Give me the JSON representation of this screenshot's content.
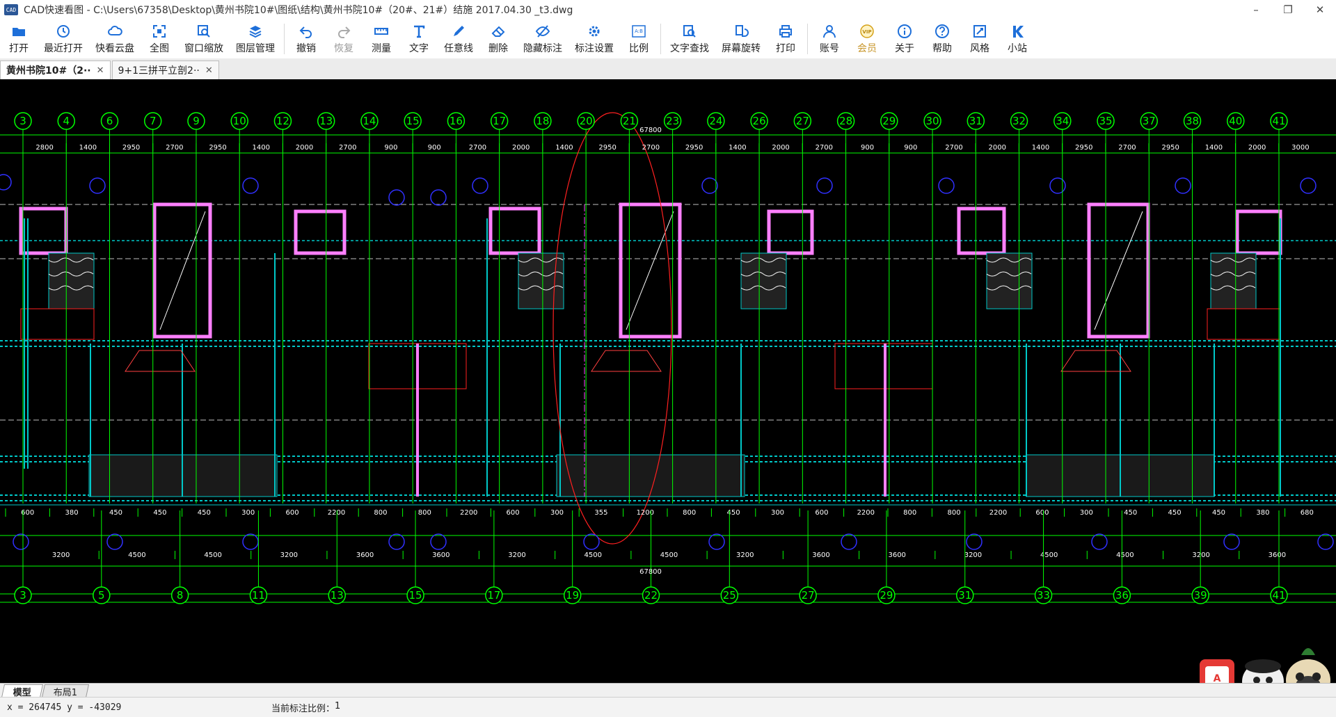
{
  "window": {
    "app_icon_text": "CAD",
    "title": "CAD快速看图 - C:\\Users\\67358\\Desktop\\黄州书院10#\\图纸\\结构\\黄州书院10#（20#、21#）结施 2017.04.30 _t3.dwg",
    "controls": {
      "minimize": "–",
      "restore": "❐",
      "close": "✕"
    }
  },
  "toolbar": {
    "items": [
      {
        "label": "打开",
        "icon": "folder-icon"
      },
      {
        "label": "最近打开",
        "icon": "clock-icon"
      },
      {
        "label": "快看云盘",
        "icon": "cloud-icon"
      },
      {
        "label": "全图",
        "icon": "fullview-icon"
      },
      {
        "label": "窗口缩放",
        "icon": "zoom-window-icon"
      },
      {
        "label": "图层管理",
        "icon": "layers-icon"
      },
      {
        "label": "撤销",
        "icon": "undo-icon"
      },
      {
        "label": "恢复",
        "icon": "redo-icon"
      },
      {
        "label": "测量",
        "icon": "ruler-icon"
      },
      {
        "label": "文字",
        "icon": "text-icon"
      },
      {
        "label": "任意线",
        "icon": "pencil-icon"
      },
      {
        "label": "删除",
        "icon": "eraser-icon"
      },
      {
        "label": "隐藏标注",
        "icon": "eye-hide-icon"
      },
      {
        "label": "标注设置",
        "icon": "gear-icon"
      },
      {
        "label": "比例",
        "icon": "scale-icon"
      },
      {
        "label": "文字查找",
        "icon": "text-search-icon"
      },
      {
        "label": "屏幕旋转",
        "icon": "rotate-icon"
      },
      {
        "label": "打印",
        "icon": "printer-icon"
      },
      {
        "label": "账号",
        "icon": "user-icon"
      },
      {
        "label": "会员",
        "icon": "vip-icon",
        "vip_badge": "VIP"
      },
      {
        "label": "关于",
        "icon": "info-icon"
      },
      {
        "label": "帮助",
        "icon": "help-icon"
      },
      {
        "label": "风格",
        "icon": "style-icon"
      },
      {
        "label": "小站",
        "icon": "station-icon"
      }
    ],
    "scale_icon_text": "A:B"
  },
  "tabs": [
    {
      "label": "黄州书院10#（2··",
      "close": "✕",
      "active": true
    },
    {
      "label": "9+1三拼平立剖2··",
      "close": "✕",
      "active": false
    }
  ],
  "drawing": {
    "top_axes": [
      "3",
      "4",
      "6",
      "7",
      "9",
      "10",
      "12",
      "13",
      "14",
      "15",
      "16",
      "17",
      "18",
      "20",
      "21",
      "23",
      "24",
      "26",
      "27",
      "28",
      "29",
      "30",
      "31",
      "32",
      "34",
      "35",
      "37",
      "38",
      "40",
      "41"
    ],
    "bottom_axes": [
      "3",
      "5",
      "8",
      "11",
      "13",
      "15",
      "17",
      "19",
      "22",
      "25",
      "27",
      "29",
      "31",
      "33",
      "36",
      "39",
      "41"
    ],
    "top_dims": [
      "2800",
      "1400",
      "2950",
      "2700",
      "2950",
      "1400",
      "2000",
      "2700",
      "900",
      "900",
      "2700",
      "2000",
      "1400",
      "2950",
      "2700",
      "2950",
      "1400",
      "2000",
      "2700",
      "900",
      "900",
      "2700",
      "2000",
      "1400",
      "2950",
      "2700",
      "2950",
      "1400",
      "2000",
      "3000"
    ],
    "top_total": "67800",
    "bottom_dims": [
      "3200",
      "4500",
      "4500",
      "3200",
      "3600",
      "3600",
      "3200",
      "4500",
      "4500",
      "3200",
      "3600",
      "3600",
      "3200",
      "4500",
      "4500",
      "3200",
      "3600"
    ],
    "bottom_total": "67800",
    "lower_dims": [
      "600",
      "380",
      "450",
      "450",
      "450",
      "300",
      "600",
      "2200",
      "800",
      "800",
      "2200",
      "600",
      "300",
      "355",
      "1200",
      "800",
      "450",
      "300",
      "600",
      "2200",
      "800",
      "800",
      "2200",
      "600",
      "300",
      "450",
      "450",
      "450",
      "380",
      "680"
    ],
    "colors": {
      "background": "#000000",
      "axis": "#00ff00",
      "wall": "#ff80ff",
      "column": "#00c8c8",
      "beam_blue": "#3030ff",
      "rebar_red": "#ff2020",
      "dimension_text": "#ffffff"
    }
  },
  "layout_tabs": [
    {
      "label": "模型",
      "active": true
    },
    {
      "label": "布局1",
      "active": false
    }
  ],
  "status": {
    "coordinates": "x = 264745  y = -43029",
    "scale_label": "当前标注比例：",
    "scale_value": "1"
  }
}
